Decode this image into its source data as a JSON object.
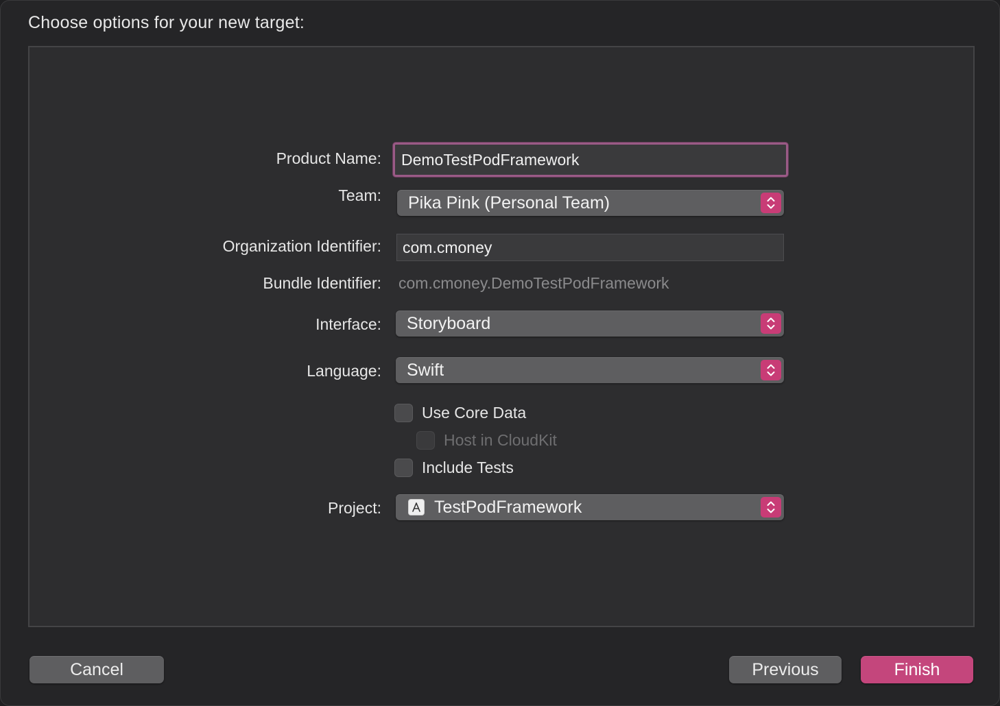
{
  "sheet": {
    "title": "Choose options for your new target:"
  },
  "form": {
    "product_name": {
      "label": "Product Name:",
      "value": "DemoTestPodFramework"
    },
    "team": {
      "label": "Team:",
      "value": "Pika Pink (Personal Team)"
    },
    "organization_identifier": {
      "label": "Organization Identifier:",
      "value": "com.cmoney"
    },
    "bundle_identifier": {
      "label": "Bundle Identifier:",
      "value": "com.cmoney.DemoTestPodFramework"
    },
    "interface": {
      "label": "Interface:",
      "value": "Storyboard"
    },
    "language": {
      "label": "Language:",
      "value": "Swift"
    },
    "use_core_data": {
      "label": "Use Core Data",
      "checked": false
    },
    "host_in_cloudkit": {
      "label": "Host in CloudKit",
      "checked": false,
      "enabled": false
    },
    "include_tests": {
      "label": "Include Tests",
      "checked": false
    },
    "project": {
      "label": "Project:",
      "value": "TestPodFramework",
      "icon": "xcode-project-icon"
    }
  },
  "buttons": {
    "cancel": "Cancel",
    "previous": "Previous",
    "finish": "Finish"
  },
  "colors": {
    "accent": "#c4467c",
    "focus_ring": "#9a5a86",
    "background": "#252527",
    "panel": "#2d2d2f"
  }
}
